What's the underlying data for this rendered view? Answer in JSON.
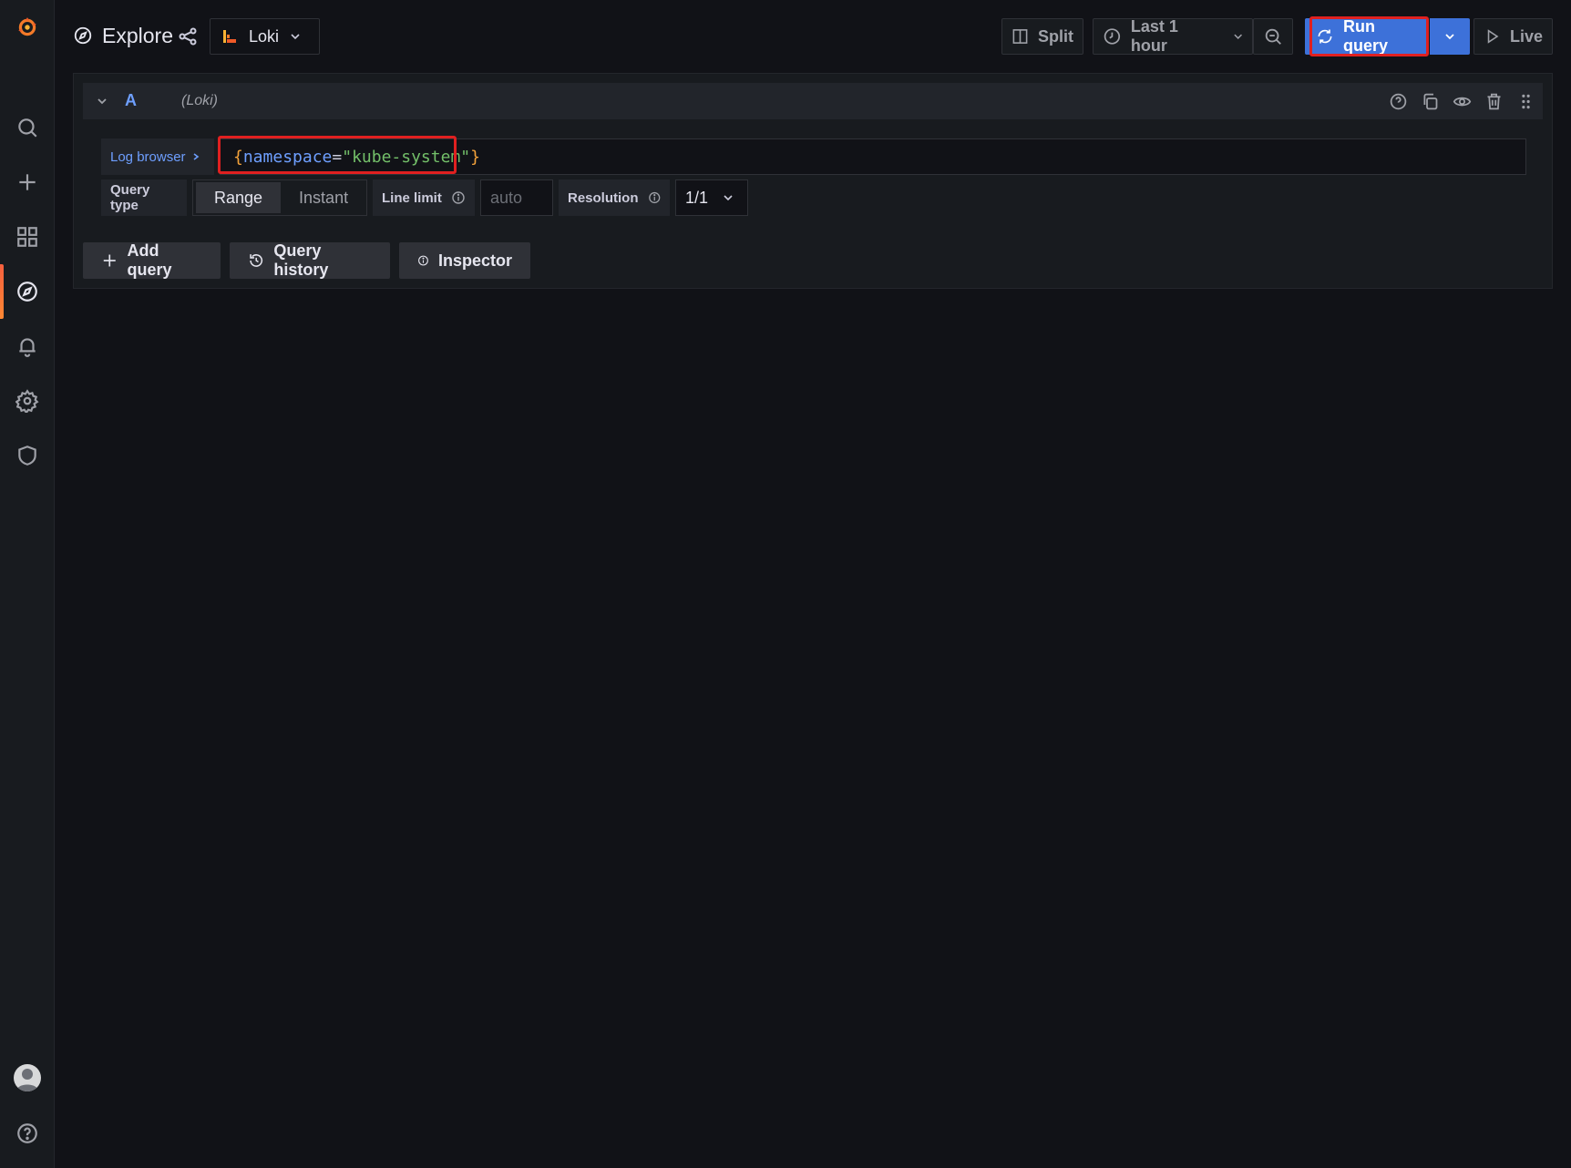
{
  "header": {
    "title": "Explore",
    "datasource": "Loki",
    "split_label": "Split",
    "time_range": "Last 1 hour",
    "run_query_label": "Run query",
    "live_label": "Live"
  },
  "query": {
    "ref_id": "A",
    "datasource_hint": "(Loki)",
    "log_browser_label": "Log browser",
    "expression": {
      "open_brace": "{",
      "label_key": "namespace",
      "operator": "=",
      "label_value": "\"kube-system\"",
      "close_brace": "}"
    },
    "query_type_label": "Query type",
    "query_type_options": [
      "Range",
      "Instant"
    ],
    "query_type_selected": "Range",
    "line_limit_label": "Line limit",
    "line_limit_placeholder": "auto",
    "resolution_label": "Resolution",
    "resolution_value": "1/1"
  },
  "actions": {
    "add_query": "Add query",
    "query_history": "Query history",
    "inspector": "Inspector"
  },
  "colors": {
    "accent_primary": "#3d71d9",
    "highlight": "#e02020",
    "brand": "#f55f3e"
  }
}
